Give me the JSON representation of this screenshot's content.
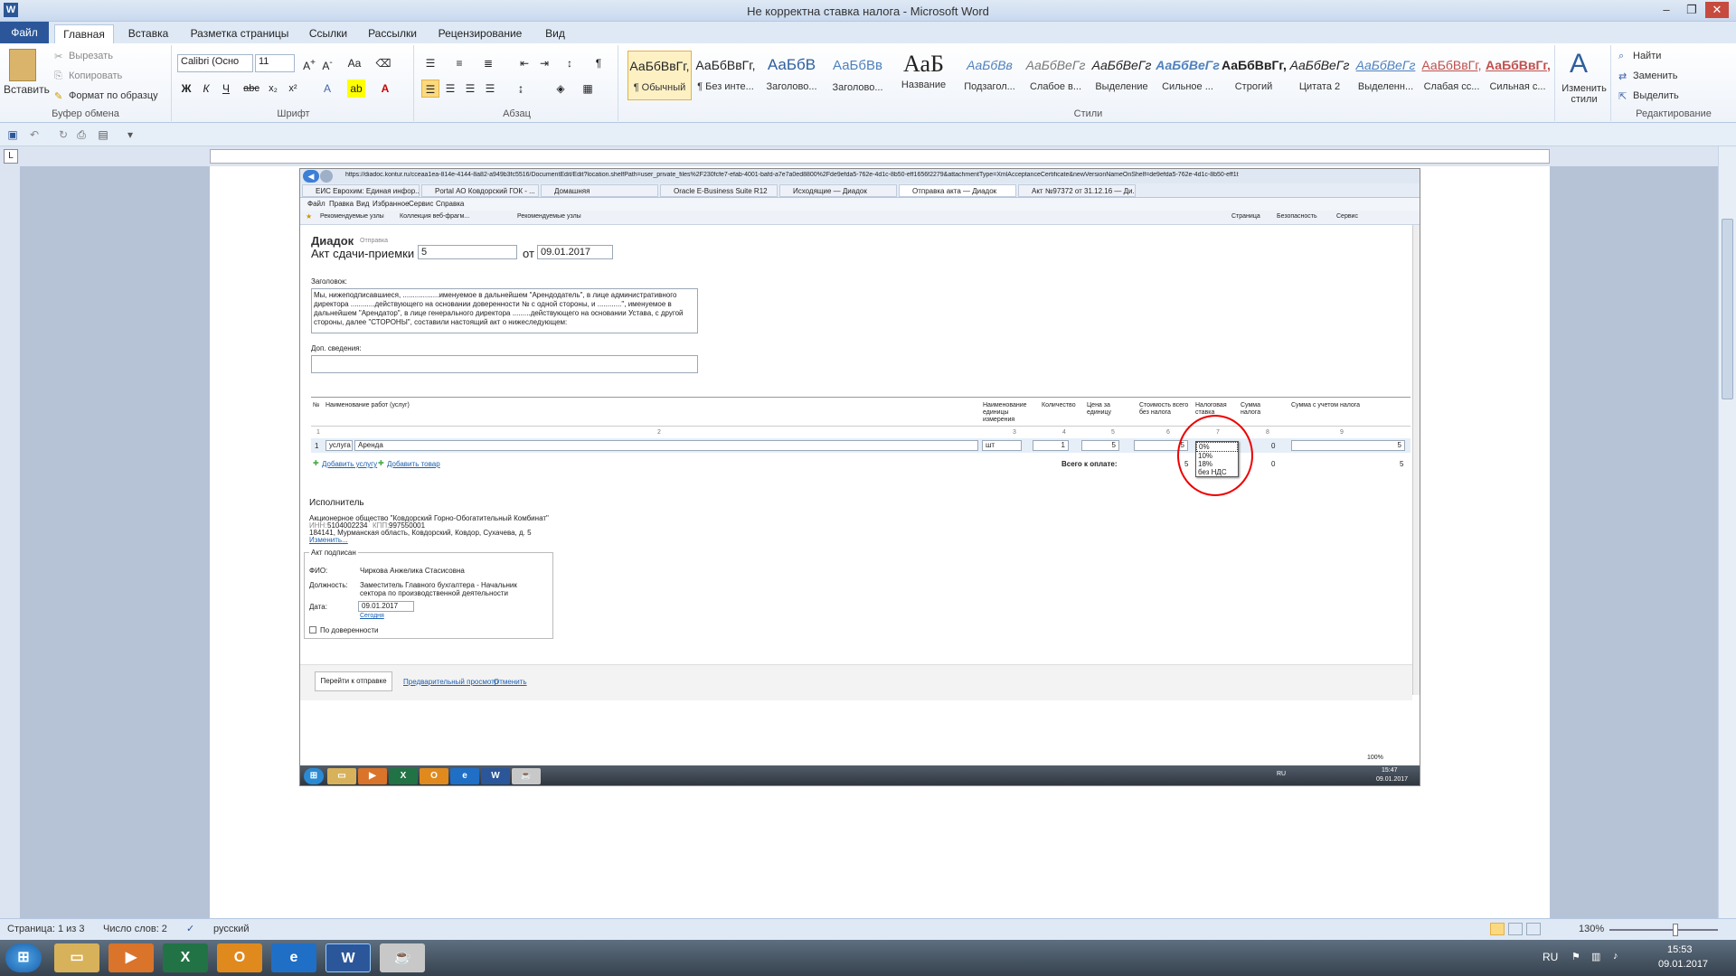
{
  "window": {
    "title": "Не корректна ставка налога - Microsoft Word"
  },
  "ribbon_tabs": [
    "Файл",
    "Главная",
    "Вставка",
    "Разметка страницы",
    "Ссылки",
    "Рассылки",
    "Рецензирование",
    "Вид"
  ],
  "clipboard": {
    "paste": "Вставить",
    "cut": "Вырезать",
    "copy": "Копировать",
    "format": "Формат по образцу",
    "label": "Буфер обмена"
  },
  "font": {
    "name": "Calibri (Осно",
    "size": "11",
    "label": "Шрифт"
  },
  "paragraph": {
    "label": "Абзац"
  },
  "styles": {
    "label": "Стили",
    "change": "Изменить стили",
    "items": [
      {
        "sample": "АаБбВвГг,",
        "name": "¶ Обычный"
      },
      {
        "sample": "АаБбВвГг,",
        "name": "¶ Без инте..."
      },
      {
        "sample": "АаБбВ",
        "name": "Заголово..."
      },
      {
        "sample": "АаБбВв",
        "name": "Заголово..."
      },
      {
        "sample": "АаБ",
        "name": "Название"
      },
      {
        "sample": "АаБбВв",
        "name": "Подзагол..."
      },
      {
        "sample": "АаБбВеГг",
        "name": "Слабое в..."
      },
      {
        "sample": "АаБбВеГг",
        "name": "Выделение"
      },
      {
        "sample": "АаБбВеГг",
        "name": "Сильное ..."
      },
      {
        "sample": "АаБбВвГг,",
        "name": "Строгий"
      },
      {
        "sample": "АаБбВеГг",
        "name": "Цитата 2"
      },
      {
        "sample": "АаБбВеГг",
        "name": "Выделенн..."
      },
      {
        "sample": "АаБбВвГг,",
        "name": "Слабая сс..."
      },
      {
        "sample": "АаБбВвГг,",
        "name": "Сильная с..."
      }
    ]
  },
  "editing": {
    "find": "Найти",
    "replace": "Заменить",
    "select": "Выделить",
    "label": "Редактирование"
  },
  "status": {
    "page": "Страница: 1 из 3",
    "words": "Число слов: 2",
    "lang": "русский",
    "zoom": "130%"
  },
  "taskbar": {
    "lang": "RU",
    "time": "15:53",
    "date": "09.01.2017"
  },
  "shot": {
    "url": "https://diadoc.kontur.ru/cceaa1ea-814e-4144-8a82-a949b3fc5516/DocumentEdit/Edit?location.shelfPath=user_private_files%2F230fcfe7-efab-4001-bafd-a7e7a0ed8800%2Fde9efda5-762e-4d1c-8b50-eff1656f2279&attachmentType=XmlAcceptanceCertificate&newVersionNameOnShelf=de9efda5-762e-4d1c-8b50-eff1t",
    "tabs": [
      "ЕИС Еврохим: Единая инфор...",
      "Portal АО Ковдорский ГОК - ...",
      "Домашняя",
      "Oracle E-Business Suite R12",
      "Исходящие — Диадок",
      "Отправка акта — Диадок",
      "Акт №97372 от 31.12.16 — Ди..."
    ],
    "menu": [
      "Файл",
      "Правка",
      "Вид",
      "Избранное",
      "Сервис",
      "Справка"
    ],
    "fav": [
      "Рекомендуемые узлы",
      "Коллекция веб-фрагм...",
      "Рекомендуемые узлы"
    ],
    "toolbar_right": [
      "Страница",
      "Безопасность",
      "Сервис"
    ],
    "brand": "Диадок",
    "crumb": "Отправка",
    "act_title": "Акт сдачи-приемки №",
    "act_num": "5",
    "from": "от",
    "act_date": "09.01.2017",
    "header_label": "Заголовок:",
    "header_text": "Мы, нижеподписавшиеся, ..................именуемое в дальнейшем \"Арендодатель\", в лице административного директора ............действующего на основании доверенности № с одной стороны, и ............\", именуемое в дальнейшем \"Арендатор\", в лице генерального директора .........действующего на основании Устава, с другой стороны, далее \"СТОРОНЫ\", составили настоящий акт о нижеследующем:",
    "extra_label": "Доп. сведения:",
    "cols": [
      "№",
      "Наименование работ (услуг)",
      "Наименование единицы измерения",
      "Количество",
      "Цена за единицу",
      "Стоимость всего без налога",
      "Налоговая ставка",
      "Сумма налога",
      "Сумма с учетом налога"
    ],
    "colnums": [
      "1",
      "2",
      "3",
      "4",
      "5",
      "6",
      "7",
      "8",
      "9"
    ],
    "row": {
      "n": "1",
      "type": "услуга",
      "name": "Аренда",
      "unit": "шт",
      "qty": "1",
      "price": "5",
      "cost": "5",
      "tax": "0",
      "total": "5"
    },
    "add_service": "Добавить услугу",
    "add_goods": "Добавить товар",
    "total_label": "Всего к оплате:",
    "total_cost": "5",
    "total_tax": "0",
    "total_sum": "5",
    "tax_options": [
      "0%",
      "10%",
      "18%",
      "без НДС"
    ],
    "executor_title": "Исполнитель",
    "executor_name": "Акционерное общество \"Ковдорский Горно-Обогатительный Комбинат\"",
    "inn_label": "ИНН:",
    "inn": "5104002234",
    "kpp_label": "КПП:",
    "kpp": "997550001",
    "address": "184141, Мурманская область, Ковдорский, Ковдор,  Сухачева, д. 5",
    "change": "Изменить...",
    "signed_title": "Акт подписан",
    "fio_label": "ФИО:",
    "fio": "Чиркова Анжелика Стасисовна",
    "pos_label": "Должность:",
    "position": "Заместитель Главного бухгалтера - Начальник сектора по производственной деятельности",
    "date_label": "Дата:",
    "sign_date": "09.01.2017",
    "today": "Сегодня",
    "proxy": "По доверенности",
    "send": "Перейти к отправке",
    "preview": "Предварительный просмотр",
    "cancel": "Отменить",
    "zoom": "100%",
    "task_lang": "RU",
    "task_time": "15:47",
    "task_date": "09.01.2017"
  }
}
